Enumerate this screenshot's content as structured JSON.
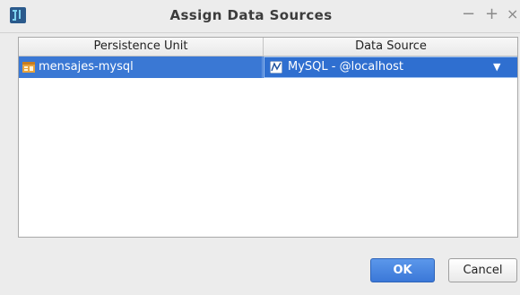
{
  "window": {
    "title": "Assign Data Sources",
    "minimize_glyph": "−",
    "maximize_glyph": "+",
    "close_glyph": "×",
    "logo_icon": "intellij-logo-icon"
  },
  "table": {
    "columns": [
      "Persistence Unit",
      "Data Source"
    ],
    "rows": [
      {
        "persistence_unit": "mensajes-mysql",
        "unit_icon": "persistence-unit-icon",
        "data_source": "MySQL - @localhost",
        "source_icon": "database-icon",
        "selected": true
      }
    ]
  },
  "buttons": {
    "ok_label": "OK",
    "cancel_label": "Cancel"
  },
  "colors": {
    "selection": "#3a78d4",
    "primary_button": "#3b78d8"
  }
}
